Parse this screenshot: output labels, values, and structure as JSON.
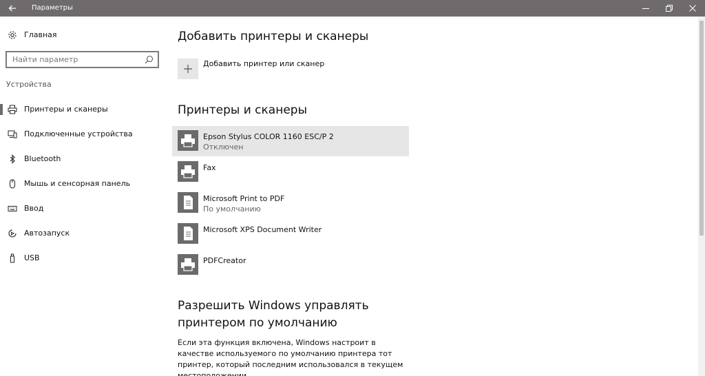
{
  "titlebar": {
    "title": "Параметры",
    "color": "#6f6b6c"
  },
  "sidebar": {
    "home_label": "Главная",
    "search_placeholder": "Найти параметр",
    "section_label": "Устройства",
    "items": [
      {
        "label": "Принтеры и сканеры",
        "icon": "printer-icon",
        "active": true
      },
      {
        "label": "Подключенные устройства",
        "icon": "devices-icon",
        "active": false
      },
      {
        "label": "Bluetooth",
        "icon": "bluetooth-icon",
        "active": false
      },
      {
        "label": "Мышь и сенсорная панель",
        "icon": "mouse-icon",
        "active": false
      },
      {
        "label": "Ввод",
        "icon": "keyboard-icon",
        "active": false
      },
      {
        "label": "Автозапуск",
        "icon": "autoplay-icon",
        "active": false
      },
      {
        "label": "USB",
        "icon": "usb-icon",
        "active": false
      }
    ]
  },
  "main": {
    "add_heading": "Добавить принтеры и сканеры",
    "add_label": "Добавить принтер или сканер",
    "printers_heading": "Принтеры и сканеры",
    "printers": [
      {
        "name": "Epson Stylus COLOR 1160 ESC/P 2",
        "status": "Отключен",
        "icon": "printer-icon",
        "selected": true
      },
      {
        "name": "Fax",
        "status": "",
        "icon": "fax-icon",
        "selected": false
      },
      {
        "name": "Microsoft Print to PDF",
        "status": "По умолчанию",
        "icon": "document-printer-icon",
        "selected": false
      },
      {
        "name": "Microsoft XPS Document Writer",
        "status": "",
        "icon": "document-printer-icon",
        "selected": false
      },
      {
        "name": "PDFCreator",
        "status": "",
        "icon": "printer-icon",
        "selected": false
      }
    ],
    "default_heading_line1": "Разрешить Windows управлять",
    "default_heading_line2": "принтером по умолчанию",
    "default_description": "Если эта функция включена, Windows настроит в качестве используемого по умолчанию принтера тот принтер, который последним использовался в текущем местоположении."
  }
}
